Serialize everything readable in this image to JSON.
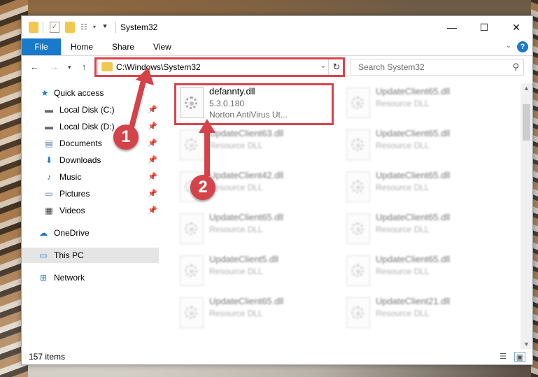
{
  "window": {
    "title": "System32",
    "controls": {
      "minimize": "—",
      "maximize": "☐",
      "close": "✕"
    }
  },
  "ribbon": {
    "tabs": [
      "File",
      "Home",
      "Share",
      "View"
    ],
    "help": "?"
  },
  "address": {
    "path": "C:\\Windows\\System32",
    "search_placeholder": "Search System32"
  },
  "sidebar": {
    "items": [
      {
        "label": "Quick access",
        "icon": "star-icon"
      },
      {
        "label": "Local Disk (C:)",
        "icon": "drive-icon",
        "pinned": true
      },
      {
        "label": "Local Disk (D:)",
        "icon": "drive-icon",
        "pinned": true
      },
      {
        "label": "Documents",
        "icon": "document-icon",
        "pinned": true
      },
      {
        "label": "Downloads",
        "icon": "download-icon",
        "pinned": true
      },
      {
        "label": "Music",
        "icon": "music-icon",
        "pinned": true
      },
      {
        "label": "Pictures",
        "icon": "picture-icon",
        "pinned": true
      },
      {
        "label": "Videos",
        "icon": "video-icon",
        "pinned": true
      },
      {
        "label": "OneDrive",
        "icon": "cloud-icon"
      },
      {
        "label": "This PC",
        "icon": "computer-icon",
        "selected": true
      },
      {
        "label": "Network",
        "icon": "network-icon"
      }
    ]
  },
  "files": {
    "highlighted": {
      "name": "defannty.dll",
      "version": "5.3.0.180",
      "description": "Norton AntiVirus Ut..."
    },
    "left_column": [
      {
        "name": "UpdateClient63.dll",
        "type": "Resource DLL"
      },
      {
        "name": "UpdateClient42.dll",
        "type": "Resource DLL"
      },
      {
        "name": "UpdateClient65.dll",
        "type": "Resource DLL"
      },
      {
        "name": "UpdateClient5.dll",
        "type": "Resource DLL"
      },
      {
        "name": "UpdateClient65.dll",
        "type": "Resource DLL"
      }
    ],
    "right_column": [
      {
        "name": "UpdateClient65.dll",
        "type": "Resource DLL"
      },
      {
        "name": "UpdateClient65.dll",
        "type": "Resource DLL"
      },
      {
        "name": "UpdateClient65.dll",
        "type": "Resource DLL"
      },
      {
        "name": "UpdateClient65.dll",
        "type": "Resource DLL"
      },
      {
        "name": "UpdateClient65.dll",
        "type": "Resource DLL"
      },
      {
        "name": "UpdateClient21.dll",
        "type": "Resource DLL"
      }
    ]
  },
  "status": {
    "item_count": "157 items"
  },
  "markers": [
    "1",
    "2"
  ],
  "colors": {
    "accent": "#1979ca",
    "highlight": "#d9434a"
  }
}
